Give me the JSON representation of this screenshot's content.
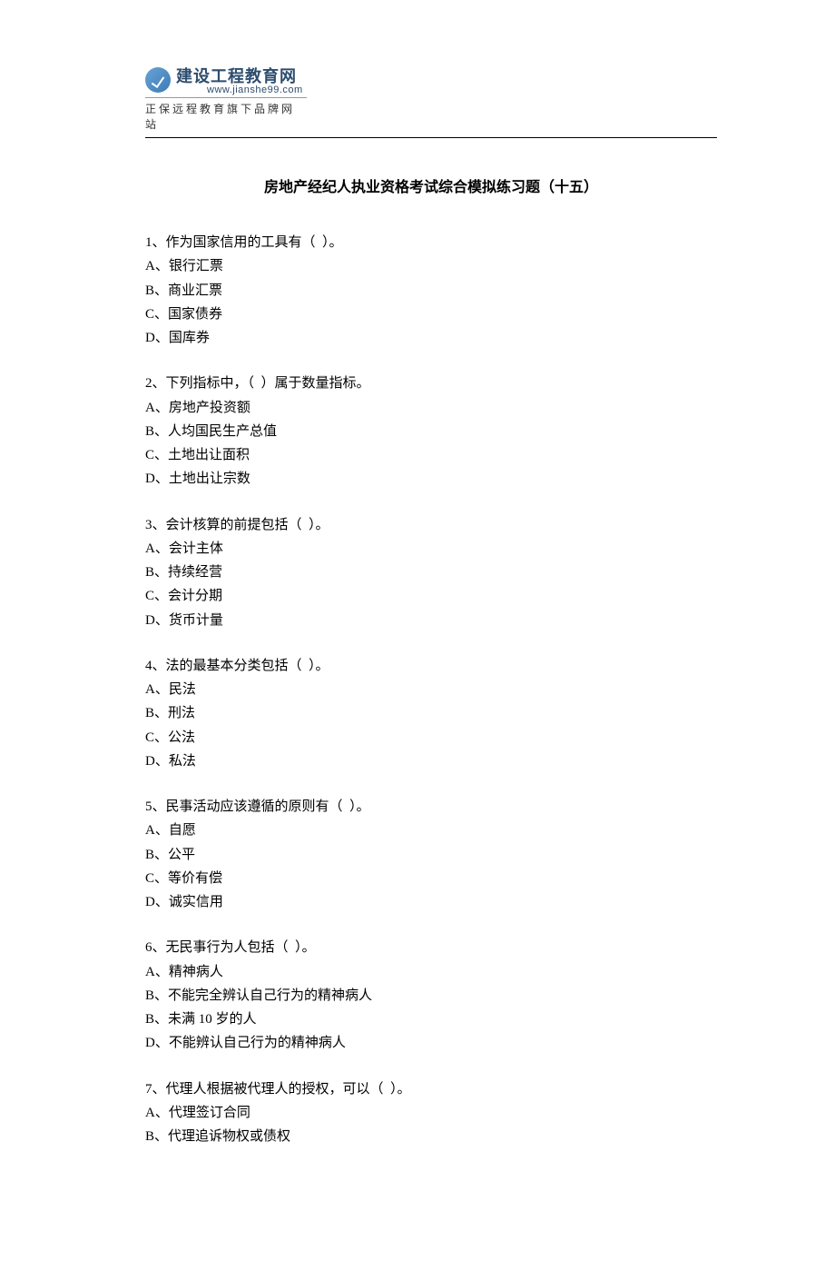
{
  "header": {
    "logo_cn": "建设工程教育网",
    "logo_url": "www.jianshe99.com",
    "logo_slogan": "正保远程教育旗下品牌网站"
  },
  "title": "房地产经纪人执业资格考试综合模拟练习题（十五）",
  "questions": [
    {
      "stem": "1、作为国家信用的工具有（  ）。",
      "options": [
        "A、银行汇票",
        "B、商业汇票",
        "C、国家债券",
        "D、国库券"
      ]
    },
    {
      "stem": "2、下列指标中，（  ）属于数量指标。",
      "options": [
        "A、房地产投资额",
        "B、人均国民生产总值",
        "C、土地出让面积",
        "D、土地出让宗数"
      ]
    },
    {
      "stem": "3、会计核算的前提包括（  ）。",
      "options": [
        "A、会计主体",
        "B、持续经营",
        "C、会计分期",
        "D、货币计量"
      ]
    },
    {
      "stem": "4、法的最基本分类包括（  ）。",
      "options": [
        "A、民法",
        "B、刑法",
        "C、公法",
        "D、私法"
      ]
    },
    {
      "stem": "5、民事活动应该遵循的原则有（  ）。",
      "options": [
        "A、自愿",
        "B、公平",
        "C、等价有偿",
        "D、诚实信用"
      ]
    },
    {
      "stem": "6、无民事行为人包括（  ）。",
      "options": [
        "A、精神病人",
        "B、不能完全辨认自己行为的精神病人",
        "B、未满 10 岁的人",
        "D、不能辨认自己行为的精神病人"
      ]
    },
    {
      "stem": "7、代理人根据被代理人的授权，可以（  ）。",
      "options": [
        "A、代理签订合同",
        "B、代理追诉物权或债权"
      ]
    }
  ]
}
